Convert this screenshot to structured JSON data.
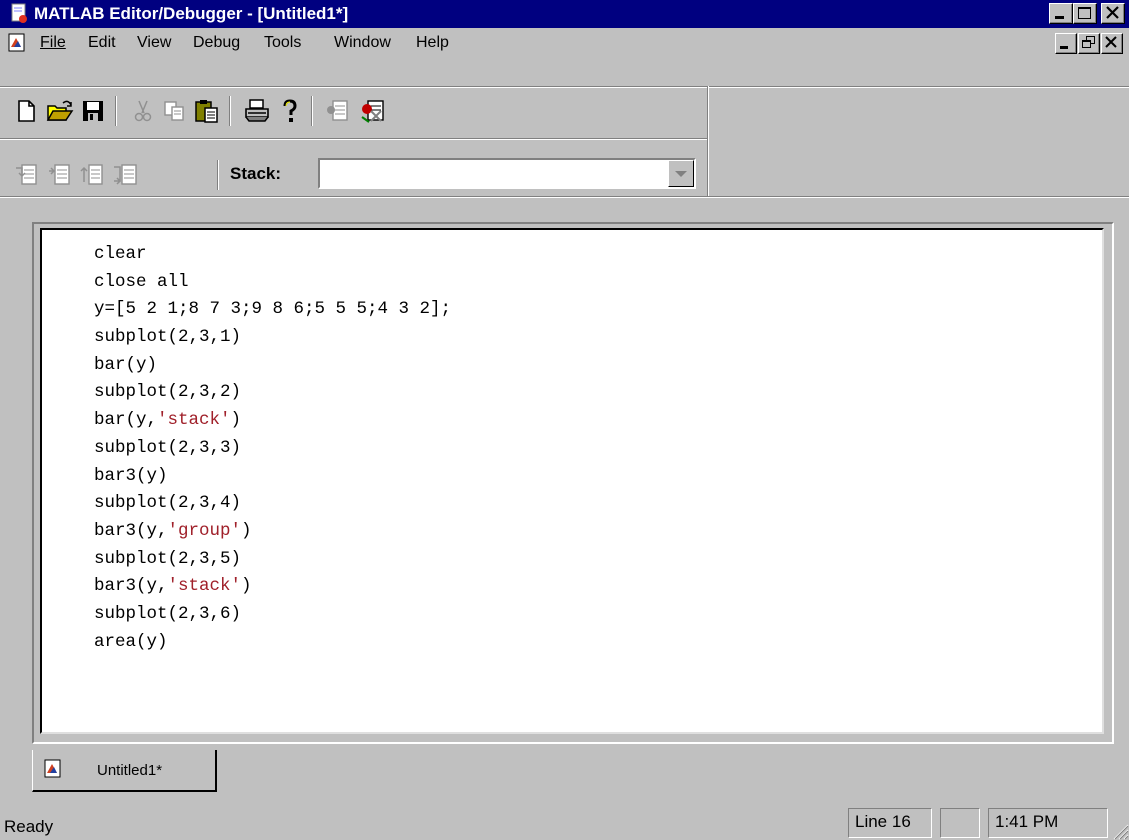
{
  "window": {
    "title": "MATLAB Editor/Debugger - [Untitled1*]"
  },
  "menu": [
    {
      "label": "File"
    },
    {
      "label": "Edit"
    },
    {
      "label": "View"
    },
    {
      "label": "Debug"
    },
    {
      "label": "Tools"
    },
    {
      "label": "Window"
    },
    {
      "label": "Help"
    }
  ],
  "toolbar": {
    "buttons": [
      "new-file-icon",
      "open-folder-icon",
      "save-icon",
      "cut-icon",
      "copy-icon",
      "paste-icon",
      "print-icon",
      "help-icon",
      "set-clear-breakpoint-icon",
      "clear-all-breakpoints-icon"
    ],
    "debug_buttons": [
      "step-in-icon",
      "step-icon",
      "step-out-icon",
      "continue-icon"
    ],
    "stack_label": "Stack:",
    "stack_value": ""
  },
  "editor": {
    "lines": [
      [
        {
          "t": "clear"
        }
      ],
      [
        {
          "t": "close all"
        }
      ],
      [
        {
          "t": "y=[5 2 1;8 7 3;9 8 6;5 5 5;4 3 2];"
        }
      ],
      [
        {
          "t": "subplot(2,3,1)"
        }
      ],
      [
        {
          "t": "bar(y)"
        }
      ],
      [
        {
          "t": "subplot(2,3,2)"
        }
      ],
      [
        {
          "t": "bar(y,"
        },
        {
          "t": "'stack'",
          "s": true
        },
        {
          "t": ")"
        }
      ],
      [
        {
          "t": "subplot(2,3,3)"
        }
      ],
      [
        {
          "t": "bar3(y)"
        }
      ],
      [
        {
          "t": "subplot(2,3,4)"
        }
      ],
      [
        {
          "t": "bar3(y,"
        },
        {
          "t": "'group'",
          "s": true
        },
        {
          "t": ")"
        }
      ],
      [
        {
          "t": "subplot(2,3,5)"
        }
      ],
      [
        {
          "t": "bar3(y,"
        },
        {
          "t": "'stack'",
          "s": true
        },
        {
          "t": ")"
        }
      ],
      [
        {
          "t": "subplot(2,3,6)"
        }
      ],
      [
        {
          "t": "area(y)"
        }
      ]
    ],
    "string_color": "#a0202a"
  },
  "tab": {
    "label": "Untitled1*"
  },
  "status": {
    "text": "Ready",
    "line": "Line 16",
    "blank": "",
    "time": "1:41 PM"
  },
  "colors": {
    "titlebar": "#000080",
    "face": "#c0c0c0"
  }
}
